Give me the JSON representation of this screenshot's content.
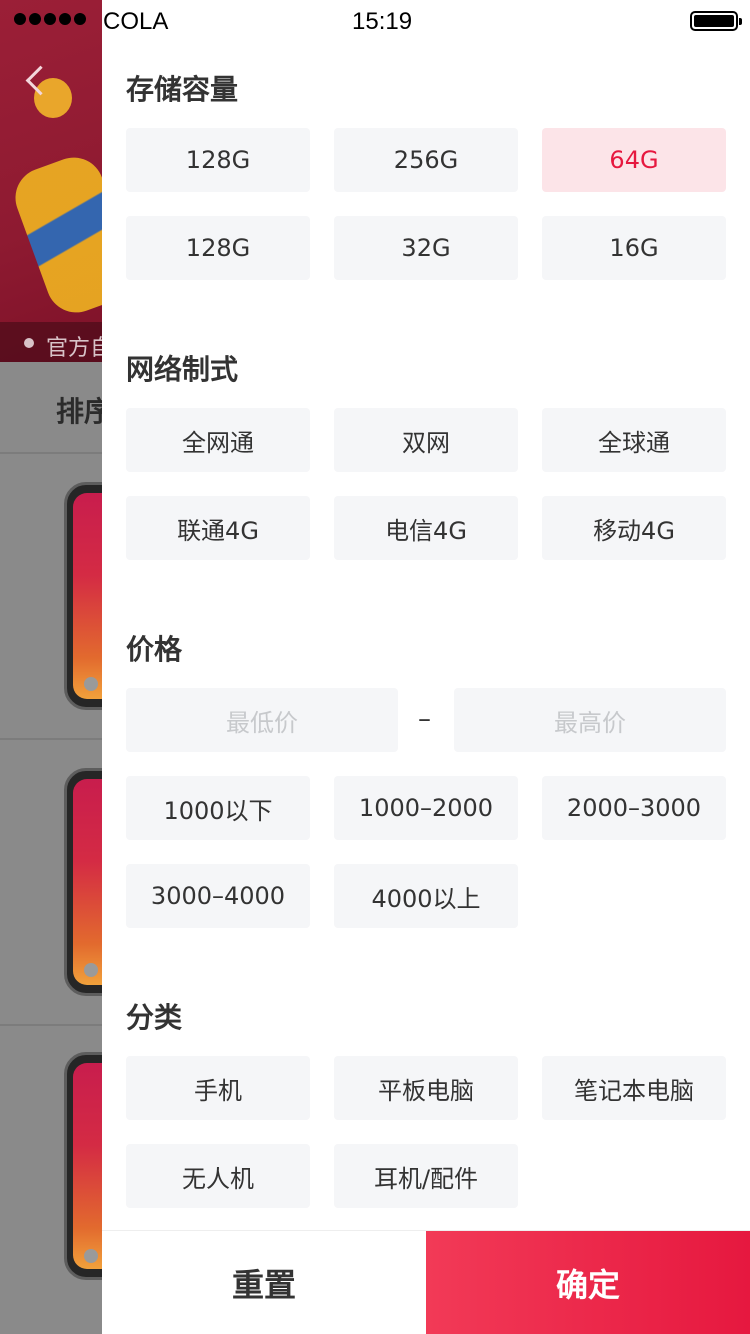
{
  "status_bar": {
    "carrier": "COLA",
    "time": "15:19"
  },
  "background": {
    "strip_text": "官方自",
    "sort_label": "排序"
  },
  "storage": {
    "title": "存储容量",
    "options": [
      {
        "label": "128G",
        "selected": false
      },
      {
        "label": "256G",
        "selected": false
      },
      {
        "label": "64G",
        "selected": true
      },
      {
        "label": "128G",
        "selected": false
      },
      {
        "label": "32G",
        "selected": false
      },
      {
        "label": "16G",
        "selected": false
      }
    ]
  },
  "network": {
    "title": "网络制式",
    "options": [
      "全网通",
      "双网",
      "全球通",
      "联通4G",
      "电信4G",
      "移动4G"
    ]
  },
  "price": {
    "title": "价格",
    "min_placeholder": "最低价",
    "separator": "–",
    "max_placeholder": "最高价",
    "options": [
      "1000以下",
      "1000–2000",
      "2000–3000",
      "3000–4000",
      "4000以上"
    ]
  },
  "category": {
    "title": "分类",
    "options": [
      "手机",
      "平板电脑",
      "笔记本电脑",
      "无人机",
      "耳机/配件"
    ]
  },
  "footer": {
    "reset_label": "重置",
    "confirm_label": "确定"
  },
  "colors": {
    "accent": "#e6183f",
    "chip_bg": "#f5f6f8",
    "selected_bg": "#fce4e8"
  }
}
